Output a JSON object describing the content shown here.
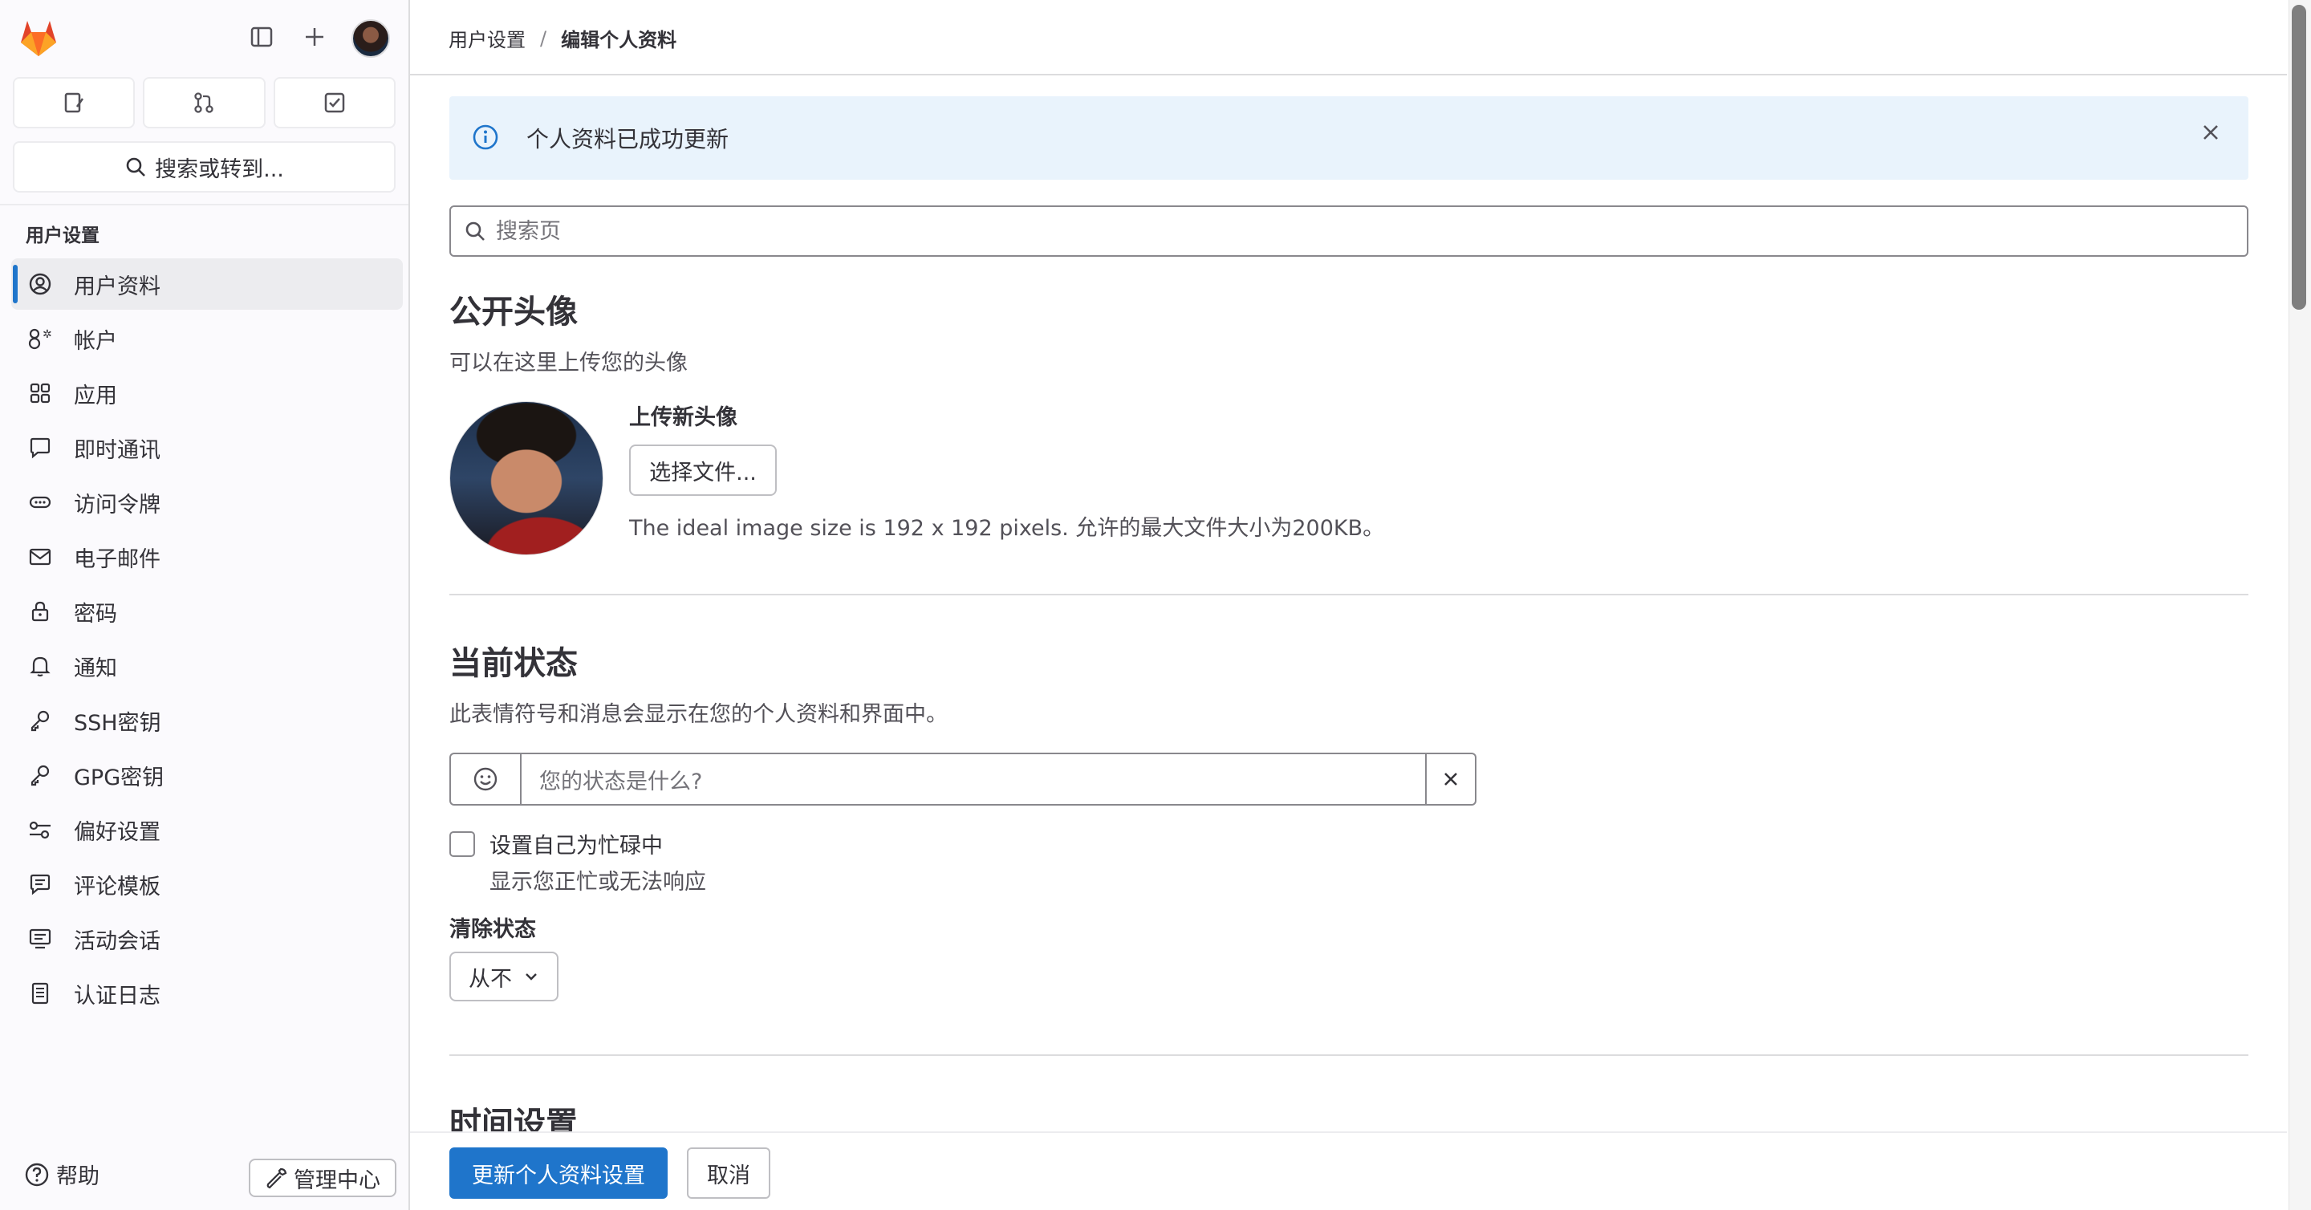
{
  "sidebar": {
    "search_label": "搜索或转到...",
    "section_title": "用户设置",
    "items": [
      {
        "label": "用户资料",
        "icon": "profile-icon",
        "active": true
      },
      {
        "label": "帐户",
        "icon": "account-icon"
      },
      {
        "label": "应用",
        "icon": "applications-icon"
      },
      {
        "label": "即时通讯",
        "icon": "chat-icon"
      },
      {
        "label": "访问令牌",
        "icon": "token-icon"
      },
      {
        "label": "电子邮件",
        "icon": "email-icon"
      },
      {
        "label": "密码",
        "icon": "lock-icon"
      },
      {
        "label": "通知",
        "icon": "bell-icon"
      },
      {
        "label": "SSH密钥",
        "icon": "key-icon"
      },
      {
        "label": "GPG密钥",
        "icon": "key-icon"
      },
      {
        "label": "偏好设置",
        "icon": "preferences-icon"
      },
      {
        "label": "评论模板",
        "icon": "comment-icon"
      },
      {
        "label": "活动会话",
        "icon": "monitor-icon"
      },
      {
        "label": "认证日志",
        "icon": "log-icon"
      }
    ],
    "help_label": "帮助",
    "admin_label": "管理中心"
  },
  "breadcrumb": {
    "parent": "用户设置",
    "current": "编辑个人资料"
  },
  "alert": {
    "message": "个人资料已成功更新"
  },
  "page_search": {
    "placeholder": "搜索页"
  },
  "avatar_section": {
    "title": "公开头像",
    "subtitle": "可以在这里上传您的头像",
    "upload_title": "上传新头像",
    "choose_button": "选择文件...",
    "help": "The ideal image size is 192 x 192 pixels. 允许的最大文件大小为200KB。"
  },
  "status_section": {
    "title": "当前状态",
    "subtitle": "此表情符号和消息会显示在您的个人资料和界面中。",
    "input_placeholder": "您的状态是什么?",
    "busy_label": "设置自己为忙碌中",
    "busy_help": "显示您正忙或无法响应",
    "clear_label": "清除状态",
    "clear_value": "从不"
  },
  "time_section": {
    "title": "时间设置"
  },
  "footer": {
    "primary_button": "更新个人资料设置",
    "cancel_button": "取消"
  },
  "colors": {
    "accent": "#1f75cb",
    "alert_bg": "#e9f3fc",
    "logo": "#e24329"
  }
}
